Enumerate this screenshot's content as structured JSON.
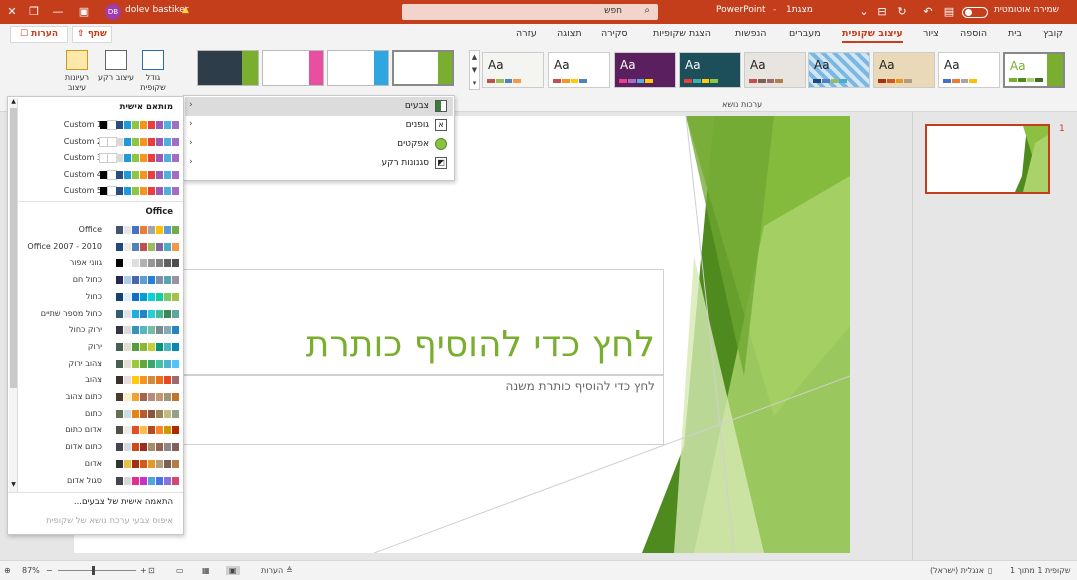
{
  "titlebar": {
    "autosave_label": "שמירה אוטומטית",
    "doc_title": "מצגת1",
    "app_name": "PowerPoint",
    "search_placeholder": "חפש",
    "user_name": "dolev bastiker",
    "user_initials": "DB"
  },
  "tabs": {
    "items": [
      "קובץ",
      "בית",
      "הוספה",
      "ציור",
      "עיצוב שקופית",
      "מעברים",
      "הנפשות",
      "הצגת שקופיות",
      "סקירה",
      "תצוגה",
      "עזרה"
    ],
    "active": "עיצוב שקופית",
    "share_label": "שתף",
    "comments_label": "הערות"
  },
  "ribbon": {
    "slide_size_label": "גודל שקופית",
    "format_bg_label": "עיצוב רקע",
    "design_ideas_label": "רעיונות עיצוב",
    "themes_group_label": "ערכות נושא",
    "theme_sample_text": "Aa"
  },
  "variants_menu": {
    "items": [
      {
        "label": "צבעים",
        "icon": "color-grid-icon",
        "selected": true
      },
      {
        "label": "גופנים",
        "icon": "font-A-icon",
        "selected": false
      },
      {
        "label": "אפקטים",
        "icon": "effects-circle-icon",
        "selected": false
      },
      {
        "label": "סגנונות רקע",
        "icon": "background-style-icon",
        "selected": false
      }
    ]
  },
  "color_panel": {
    "custom_header": "מותאם אישית",
    "office_header": "Office",
    "custom": [
      {
        "name": "Custom 1",
        "colors": [
          "#000000",
          "#ffffff",
          "#2b4c7e",
          "#1f9ad6",
          "#8dc63f",
          "#f7941d",
          "#e83e3e",
          "#9b59b6",
          "#4fb0e0",
          "#a36dc5"
        ]
      },
      {
        "name": "Custom 2",
        "colors": [
          "#ffffff",
          "#ffffff",
          "#d9d9d9",
          "#1f9ad6",
          "#8dc63f",
          "#f7941d",
          "#e83e3e",
          "#9b59b6",
          "#4fb0e0",
          "#a36dc5"
        ]
      },
      {
        "name": "Custom 3",
        "colors": [
          "#ffffff",
          "#ffffff",
          "#d9d9d9",
          "#1f9ad6",
          "#8dc63f",
          "#f7941d",
          "#e83e3e",
          "#9b59b6",
          "#4fb0e0",
          "#a36dc5"
        ]
      },
      {
        "name": "Custom 4",
        "colors": [
          "#000000",
          "#ffffff",
          "#2b4c7e",
          "#1f9ad6",
          "#8dc63f",
          "#f7941d",
          "#e83e3e",
          "#9b59b6",
          "#4fb0e0",
          "#a36dc5"
        ]
      },
      {
        "name": "Custom 5",
        "colors": [
          "#000000",
          "#ffffff",
          "#2b4c7e",
          "#1f9ad6",
          "#8dc63f",
          "#f7941d",
          "#e83e3e",
          "#9b59b6",
          "#4fb0e0",
          "#a36dc5"
        ]
      }
    ],
    "office": [
      {
        "name": "Office",
        "colors": [
          "#44546a",
          "#e7e6e6",
          "#4472c4",
          "#ed7d31",
          "#a5a5a5",
          "#ffc000",
          "#5b9bd5",
          "#70ad47"
        ]
      },
      {
        "name": "Office 2007 - 2010",
        "colors": [
          "#1f497d",
          "#eeece1",
          "#4f81bd",
          "#c0504d",
          "#9bbb59",
          "#8064a2",
          "#4bacc6",
          "#f79646"
        ]
      },
      {
        "name": "גווני אפור",
        "colors": [
          "#000000",
          "#f8f8f8",
          "#dddddd",
          "#b2b2b2",
          "#969696",
          "#808080",
          "#5f5f5f",
          "#4d4d4d"
        ]
      },
      {
        "name": "כחול חם",
        "colors": [
          "#242852",
          "#acccea",
          "#4a66ac",
          "#629dd1",
          "#297fd5",
          "#7f8fa9",
          "#5aa2ae",
          "#9d90a0"
        ]
      },
      {
        "name": "כחול",
        "colors": [
          "#17406d",
          "#dbeff9",
          "#0f6fc6",
          "#009dd9",
          "#0bd0d9",
          "#10cf9b",
          "#7cca62",
          "#a5c249"
        ]
      },
      {
        "name": "כחול מספר שתיים",
        "colors": [
          "#335b74",
          "#dfe3e5",
          "#1cade4",
          "#2683c6",
          "#27ced7",
          "#42ba97",
          "#3e8853",
          "#62a39f"
        ]
      },
      {
        "name": "ירוק כחול",
        "colors": [
          "#373545",
          "#dedbd6",
          "#3494ba",
          "#58b6c0",
          "#75bda7",
          "#7a8c8e",
          "#84acb6",
          "#2683c6"
        ]
      },
      {
        "name": "ירוק",
        "colors": [
          "#455f51",
          "#e3ded1",
          "#549e39",
          "#8ab833",
          "#c0cf3a",
          "#029676",
          "#4ab5c4",
          "#0989b1"
        ]
      },
      {
        "name": "צהוב ירוק",
        "colors": [
          "#455f51",
          "#e3ded1",
          "#99cb38",
          "#63a537",
          "#37a76f",
          "#44c1a3",
          "#4eb3cf",
          "#51c3f9"
        ]
      },
      {
        "name": "צהוב",
        "colors": [
          "#39302a",
          "#e5dedb",
          "#ffca08",
          "#f8931d",
          "#ce8d3e",
          "#ec7016",
          "#e64823",
          "#9c6a6a"
        ]
      },
      {
        "name": "כתום צהוב",
        "colors": [
          "#4e3b30",
          "#fbeec9",
          "#f0a22e",
          "#a5644e",
          "#b58b80",
          "#c3986d",
          "#a19574",
          "#c17529"
        ]
      },
      {
        "name": "כתום",
        "colors": [
          "#637052",
          "#ccddea",
          "#e48312",
          "#bd582c",
          "#865640",
          "#9b8357",
          "#c2bc80",
          "#94a088"
        ]
      },
      {
        "name": "אדום כתום",
        "colors": [
          "#505046",
          "#eeece1",
          "#e84c22",
          "#ffbd47",
          "#b64926",
          "#ff8427",
          "#cc9900",
          "#b22600"
        ]
      },
      {
        "name": "כתום אדום",
        "colors": [
          "#454551",
          "#d8d9dc",
          "#d34817",
          "#9b2d1f",
          "#a28e6a",
          "#956251",
          "#918485",
          "#855d5d"
        ]
      },
      {
        "name": "אדום",
        "colors": [
          "#323232",
          "#e5c243",
          "#a5300f",
          "#d55816",
          "#e19825",
          "#b19c7d",
          "#7f5f52",
          "#b27d49"
        ]
      },
      {
        "name": "סגול אדום",
        "colors": [
          "#454551",
          "#d8d9dc",
          "#e32d91",
          "#c830cc",
          "#4ea6dc",
          "#4775e7",
          "#8971e1",
          "#d54773"
        ]
      }
    ],
    "customize_label": "התאמה אישית של צבעים...",
    "reset_label": "איפוס צבעי ערכת נושא של שקופית"
  },
  "slide": {
    "title_placeholder": "לחץ כדי להוסיף כותרת",
    "subtitle_placeholder": "לחץ כדי להוסיף כותרת משנה",
    "accent": "#7aae2e"
  },
  "thumbnails": {
    "slide_number": "1"
  },
  "statusbar": {
    "slide_info": "שקופית 1 מתוך 1",
    "language": "אנגלית (ישראל)",
    "notes_label": "הערות",
    "zoom": "87%"
  },
  "colors": {
    "brand": "#c43e1c",
    "green_dark": "#4e8a1e",
    "green_light": "#a9d26a"
  }
}
